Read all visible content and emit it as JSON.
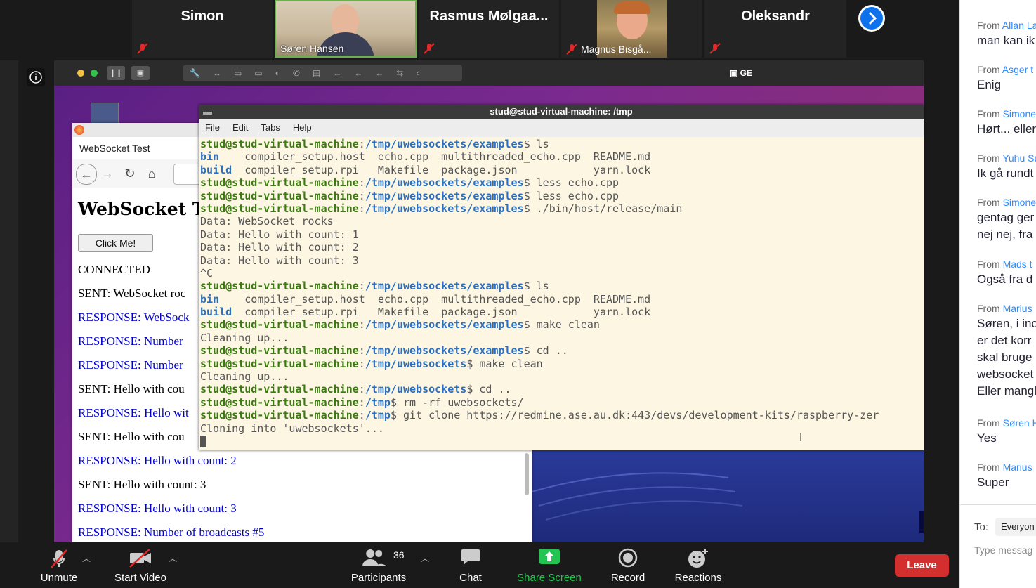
{
  "participants": [
    {
      "name": "Simon",
      "muted": true
    },
    {
      "name": "Søren Hansen",
      "muted": false,
      "video": true
    },
    {
      "name": "Rasmus  Mølgaa...",
      "muted": true
    },
    {
      "name": "Magnus Bisgå...",
      "muted": true,
      "video": true
    },
    {
      "name": "Oleksandr",
      "muted": true
    }
  ],
  "vm": {
    "window_label": "GE"
  },
  "firefox": {
    "tab_title": "WebSocket Test",
    "heading": "WebSocket Te",
    "button_label": "Click Me!",
    "log": [
      {
        "text": "CONNECTED",
        "kind": "sent"
      },
      {
        "text": "SENT: WebSocket roc",
        "kind": "sent"
      },
      {
        "text": "RESPONSE: WebSock",
        "kind": "resp"
      },
      {
        "text": "RESPONSE: Number",
        "kind": "resp"
      },
      {
        "text": "RESPONSE: Number",
        "kind": "resp"
      },
      {
        "text": "SENT: Hello with cou",
        "kind": "sent"
      },
      {
        "text": "RESPONSE: Hello wit",
        "kind": "resp"
      },
      {
        "text": "SENT: Hello with cou",
        "kind": "sent"
      },
      {
        "text": "RESPONSE: Hello with count: 2",
        "kind": "resp"
      },
      {
        "text": "SENT: Hello with count: 3",
        "kind": "sent"
      },
      {
        "text": "RESPONSE: Hello with count: 3",
        "kind": "resp"
      },
      {
        "text": "RESPONSE: Number of broadcasts #5",
        "kind": "resp"
      }
    ]
  },
  "terminal": {
    "title": "stud@stud-virtual-machine: /tmp",
    "menu": [
      "File",
      "Edit",
      "Tabs",
      "Help"
    ],
    "lines": [
      {
        "user": "stud@stud-virtual-machine",
        "path": "/tmp/uwebsockets/examples",
        "cmd": "ls"
      },
      {
        "dir": "bin",
        "rest": "    compiler_setup.host  echo.cpp  multithreaded_echo.cpp  README.md"
      },
      {
        "dir": "build",
        "rest": "  compiler_setup.rpi   Makefile  package.json            yarn.lock"
      },
      {
        "user": "stud@stud-virtual-machine",
        "path": "/tmp/uwebsockets/examples",
        "cmd": "less echo.cpp"
      },
      {
        "user": "stud@stud-virtual-machine",
        "path": "/tmp/uwebsockets/examples",
        "cmd": "less echo.cpp"
      },
      {
        "user": "stud@stud-virtual-machine",
        "path": "/tmp/uwebsockets/examples",
        "cmd": "./bin/host/release/main"
      },
      {
        "out": "Data: WebSocket rocks"
      },
      {
        "out": "Data: Hello with count: 1"
      },
      {
        "out": "Data: Hello with count: 2"
      },
      {
        "out": "Data: Hello with count: 3"
      },
      {
        "out": "^C"
      },
      {
        "user": "stud@stud-virtual-machine",
        "path": "/tmp/uwebsockets/examples",
        "cmd": "ls"
      },
      {
        "dir": "bin",
        "rest": "    compiler_setup.host  echo.cpp  multithreaded_echo.cpp  README.md"
      },
      {
        "dir": "build",
        "rest": "  compiler_setup.rpi   Makefile  package.json            yarn.lock"
      },
      {
        "user": "stud@stud-virtual-machine",
        "path": "/tmp/uwebsockets/examples",
        "cmd": "make clean"
      },
      {
        "out": "Cleaning up..."
      },
      {
        "user": "stud@stud-virtual-machine",
        "path": "/tmp/uwebsockets/examples",
        "cmd": "cd .."
      },
      {
        "user": "stud@stud-virtual-machine",
        "path": "/tmp/uwebsockets",
        "cmd": "make clean"
      },
      {
        "out": "Cleaning up..."
      },
      {
        "user": "stud@stud-virtual-machine",
        "path": "/tmp/uwebsockets",
        "cmd": "cd .."
      },
      {
        "user": "stud@stud-virtual-machine",
        "path": "/tmp",
        "cmd": "rm -rf uwebsockets/"
      },
      {
        "user": "stud@stud-virtual-machine",
        "path": "/tmp",
        "cmd": "git clone https://redmine.ase.au.dk:443/devs/development-kits/raspberry-zer"
      },
      {
        "out": "Cloning into 'uwebsockets'..."
      }
    ]
  },
  "chat": {
    "messages": [
      {
        "from_prefix": "From",
        "sender": "Allan La",
        "text": "man kan ik"
      },
      {
        "from_prefix": "From",
        "sender": "Asger t",
        "text": "Enig"
      },
      {
        "from_prefix": "From",
        "sender": "Simone",
        "text": "Hørt... eller"
      },
      {
        "from_prefix": "From",
        "sender": "Yuhu Su",
        "text": "Ik gå rundt"
      },
      {
        "from_prefix": "From",
        "sender": "Simone",
        "text": "gentag ger",
        "text2": "nej nej, fra"
      },
      {
        "from_prefix": "From",
        "sender": "Mads t",
        "text": "Også fra d"
      },
      {
        "from_prefix": "From",
        "sender": "Marius",
        "text": "Søren, i inc",
        "text2": "er det korr",
        "text3": "skal bruge",
        "text4": "websocket",
        "text5": "Eller mangl"
      },
      {
        "from_prefix": "From",
        "sender": "Søren H",
        "text": "Yes"
      },
      {
        "from_prefix": "From",
        "sender": "Marius",
        "text": "Super"
      }
    ],
    "to_label": "To:",
    "to_value": "Everyon",
    "input_placeholder": "Type messag"
  },
  "toolbar": {
    "unmute": "Unmute",
    "start_video": "Start Video",
    "participants": "Participants",
    "participants_count": "36",
    "chat": "Chat",
    "share_screen": "Share Screen",
    "record": "Record",
    "reactions": "Reactions",
    "leave": "Leave"
  },
  "colors": {
    "share_green": "#23c552",
    "leave_red": "#d32f2f",
    "link_blue": "#2d8cff"
  }
}
